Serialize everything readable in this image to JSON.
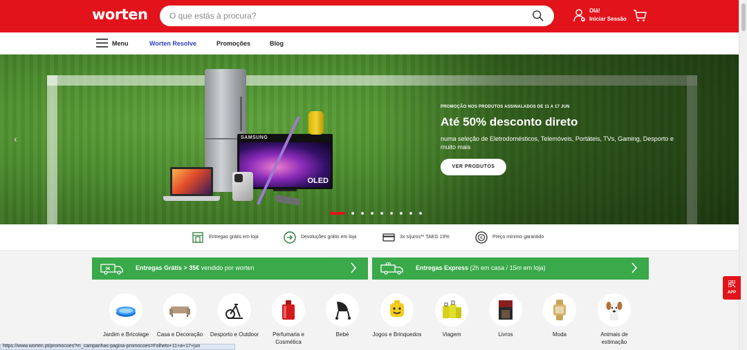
{
  "header": {
    "logo": "worten",
    "search": {
      "placeholder": "O que estás à procura?"
    },
    "user": {
      "greeting": "Olá!",
      "login": "Iniciar Sessão"
    }
  },
  "nav": {
    "menu_label": "Menu",
    "items": [
      {
        "label": "Worten Resolve"
      },
      {
        "label": "Promoções"
      },
      {
        "label": "Blog"
      }
    ]
  },
  "hero": {
    "kicker": "PROMOÇÃO NOS PRODUTOS ASSINALADOS DE 11 A 17 JUN",
    "headline": "Até 50% desconto direto",
    "subtitle": "numa seleção de Eletrodomésticos, Telemóveis, Portáteis, TVs, Gaming, Desporto e muito mais",
    "cta": "VER PRODUTOS",
    "tv_brand": "SAMSUNG",
    "tv_badge": "OLED",
    "slides_total": 9,
    "slide_active": 1
  },
  "perks": [
    {
      "label": "Entregas grátis em loja",
      "icon": "store-icon"
    },
    {
      "label": "Devoluções grátis em loja",
      "icon": "return-icon"
    },
    {
      "label": "3x s/juros** TAEG 19%",
      "icon": "card-icon"
    },
    {
      "label": "Preço mínimo garantido",
      "icon": "price-icon"
    }
  ],
  "banners": [
    {
      "bold": "Entregas Grátis > 35€",
      "rest": " vendido por worten",
      "icon_text": "0€"
    },
    {
      "bold": "Entregas Express",
      "rest": " (2h em casa / 15m em loja)",
      "icon_text": "2h"
    }
  ],
  "app_button": "APP",
  "categories": [
    {
      "label": "Jardim e Bricolage",
      "icon": "pool-icon"
    },
    {
      "label": "Casa e Decoração",
      "icon": "sofa-icon"
    },
    {
      "label": "Desporto e Outdoor",
      "icon": "bike-icon"
    },
    {
      "label": "Perfumaria e Cosmética",
      "icon": "perfume-icon"
    },
    {
      "label": "Bebé",
      "icon": "stroller-icon"
    },
    {
      "label": "Jogos e Brinquedos",
      "icon": "lego-icon"
    },
    {
      "label": "Viagem",
      "icon": "luggage-icon"
    },
    {
      "label": "Livros",
      "icon": "book-icon"
    },
    {
      "label": "Moda",
      "icon": "watch-icon"
    },
    {
      "label": "Animais de estimação",
      "icon": "dog-icon"
    }
  ],
  "status_url": "https://www.worten.pt/promocoes?m_campanhas-pagina-promocoes=Folheto+11+a+17+jun",
  "colors": {
    "brand_red": "#e3131b",
    "green": "#39a94a",
    "nav_active": "#2c3ec4"
  }
}
